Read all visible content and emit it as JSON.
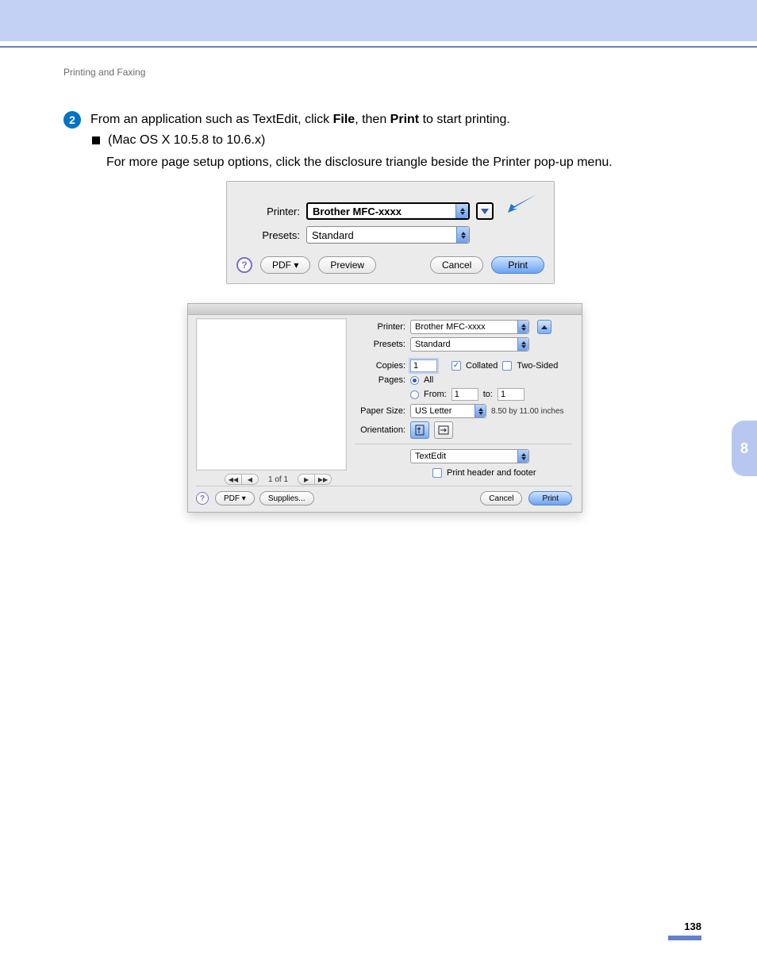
{
  "section_header": "Printing and Faxing",
  "step": {
    "number": "2",
    "pre": "From an application such as TextEdit, click ",
    "bold1": "File",
    "mid": ", then ",
    "bold2": "Print",
    "post": " to start printing."
  },
  "sub": {
    "version": "(Mac OS X 10.5.8 to 10.6.x)",
    "instruction": "For more page setup options, click the disclosure triangle beside the Printer pop-up menu."
  },
  "dialog_collapsed": {
    "printer_label": "Printer:",
    "printer_value": "Brother MFC-xxxx",
    "presets_label": "Presets:",
    "presets_value": "Standard",
    "help": "?",
    "pdf_label": "PDF ▾",
    "preview_label": "Preview",
    "cancel_label": "Cancel",
    "print_label": "Print"
  },
  "dialog_expanded": {
    "printer_label": "Printer:",
    "printer_value": "Brother MFC-xxxx",
    "presets_label": "Presets:",
    "presets_value": "Standard",
    "copies_label": "Copies:",
    "copies_value": "1",
    "collated_label": "Collated",
    "two_sided_label": "Two-Sided",
    "pages_label": "Pages:",
    "pages_all": "All",
    "pages_from": "From:",
    "pages_from_value": "1",
    "pages_to": "to:",
    "pages_to_value": "1",
    "paper_size_label": "Paper Size:",
    "paper_size_value": "US Letter",
    "paper_size_dims": "8.50 by 11.00 inches",
    "orientation_label": "Orientation:",
    "section_select": "TextEdit",
    "header_footer_label": "Print header and footer",
    "pager_text": "1 of 1",
    "help": "?",
    "pdf_label": "PDF ▾",
    "supplies_label": "Supplies...",
    "cancel_label": "Cancel",
    "print_label": "Print"
  },
  "chapter": "8",
  "page_number": "138"
}
